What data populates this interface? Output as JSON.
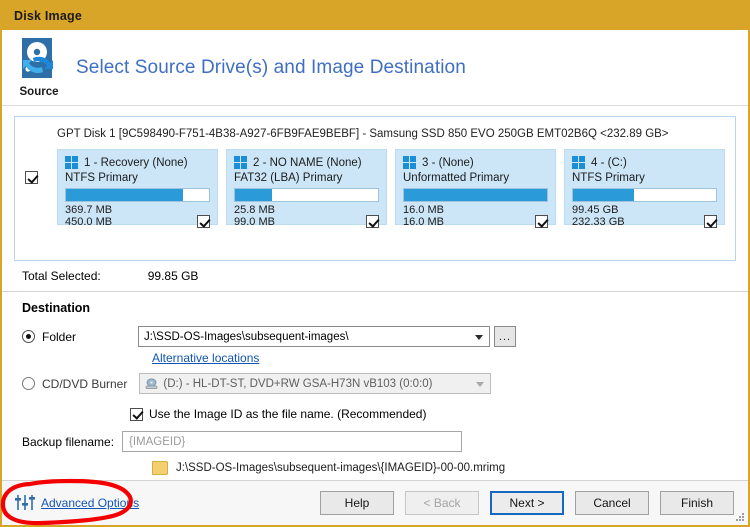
{
  "window": {
    "title": "Disk Image"
  },
  "header": {
    "icon_name": "disk-source-icon",
    "source_label": "Source",
    "title": "Select Source Drive(s) and Image Destination"
  },
  "disk": {
    "info_line": "GPT Disk 1 [9C598490-F751-4B38-A927-6FB9FAE9BEBF] - Samsung SSD 850 EVO 250GB EMT02B6Q  <232.89 GB>",
    "master_checked": true,
    "partitions": [
      {
        "name": "1 - Recovery (None)",
        "filesystem": "NTFS Primary",
        "used": "369.7 MB",
        "total": "450.0 MB",
        "fill_percent": 82,
        "checked": true
      },
      {
        "name": "2 - NO NAME (None)",
        "filesystem": "FAT32 (LBA) Primary",
        "used": "25.8 MB",
        "total": "99.0 MB",
        "fill_percent": 26,
        "checked": true
      },
      {
        "name": "3 -  (None)",
        "filesystem": "Unformatted Primary",
        "used": "16.0 MB",
        "total": "16.0 MB",
        "fill_percent": 100,
        "checked": true
      },
      {
        "name": "4 -  (C:)",
        "filesystem": "NTFS Primary",
        "used": "99.45 GB",
        "total": "232.33 GB",
        "fill_percent": 43,
        "checked": true
      }
    ]
  },
  "total": {
    "label": "Total Selected:",
    "value": "99.85 GB"
  },
  "destination": {
    "title": "Destination",
    "folder_radio_label": "Folder",
    "folder_radio_selected": true,
    "folder_path": "J:\\SSD-OS-Images\\subsequent-images\\",
    "alternative_locations_link": "Alternative locations",
    "cd_radio_label": "CD/DVD Burner",
    "cd_radio_selected": false,
    "cd_device": "(D:) - HL-DT-ST, DVD+RW GSA-H73N vB103 (0:0:0)",
    "use_image_id_label": "Use the Image ID as the file name.  (Recommended)",
    "use_image_id_checked": true,
    "filename_label": "Backup filename:",
    "filename_value": "{IMAGEID}",
    "full_path": "J:\\SSD-OS-Images\\subsequent-images\\{IMAGEID}-00-00.mrimg",
    "browse_button_label": "..."
  },
  "footer": {
    "advanced_options_label": "Advanced Options",
    "sliders_icon_name": "sliders-icon",
    "buttons": [
      {
        "label": "Help",
        "state": "normal"
      },
      {
        "label": "< Back",
        "state": "disabled"
      },
      {
        "label": "Next >",
        "state": "focused"
      },
      {
        "label": "Cancel",
        "state": "normal"
      },
      {
        "label": "Finish",
        "state": "normal"
      }
    ]
  },
  "annotation": {
    "shape": "red-ellipse-highlight",
    "color": "#f40000"
  },
  "colors": {
    "titlebar": "#d9a528",
    "accent_link": "#1255b5",
    "header_title": "#3f6fc4",
    "partition_panel": "#cce6f7",
    "bar_fill": "#2b9ad9",
    "annotation_red": "#f40000"
  }
}
